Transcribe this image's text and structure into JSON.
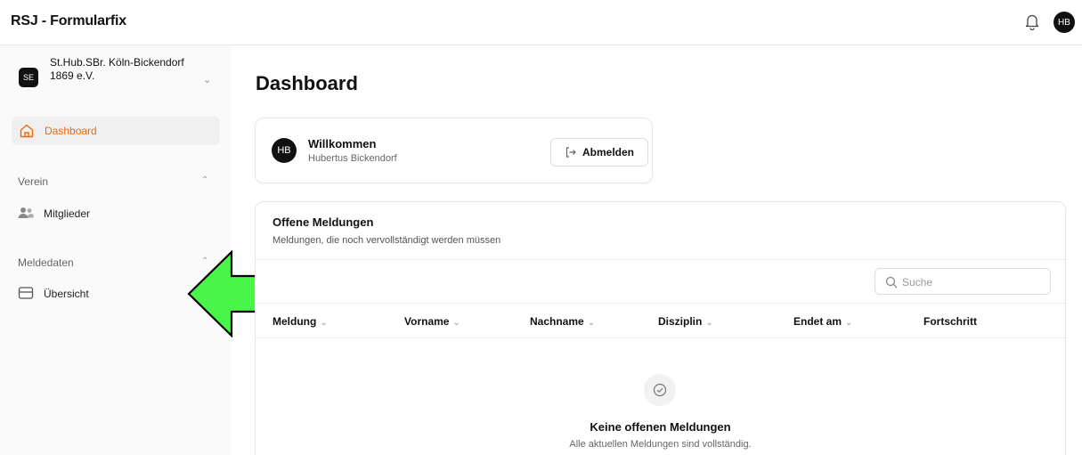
{
  "app": {
    "title": "RSJ - Formularfix",
    "user_initials": "HB"
  },
  "sidebar": {
    "org_badge": "SE",
    "org_name": "St.Hub.SBr. Köln-Bickendorf 1869 e.V.",
    "dashboard_label": "Dashboard",
    "sections": [
      {
        "title": "Verein",
        "items": [
          {
            "label": "Mitglieder",
            "icon": "users-icon"
          }
        ]
      },
      {
        "title": "Meldedaten",
        "items": [
          {
            "label": "Übersicht",
            "icon": "inbox-icon"
          }
        ]
      }
    ]
  },
  "main": {
    "page_title": "Dashboard",
    "welcome": {
      "initials": "HB",
      "greeting": "Willkommen",
      "user_name": "Hubertus Bickendorf",
      "logout_label": "Abmelden"
    },
    "reports": {
      "title": "Offene Meldungen",
      "subtitle": "Meldungen, die noch vervollständigt werden müssen",
      "search_placeholder": "Suche",
      "columns": [
        "Meldung",
        "Vorname",
        "Nachname",
        "Disziplin",
        "Endet am",
        "Fortschritt"
      ],
      "empty_title": "Keine offenen Meldungen",
      "empty_subtitle": "Alle aktuellen Meldungen sind vollständig."
    }
  },
  "colors": {
    "accent": "#ea6a12",
    "annotation_arrow": "#49f549"
  }
}
